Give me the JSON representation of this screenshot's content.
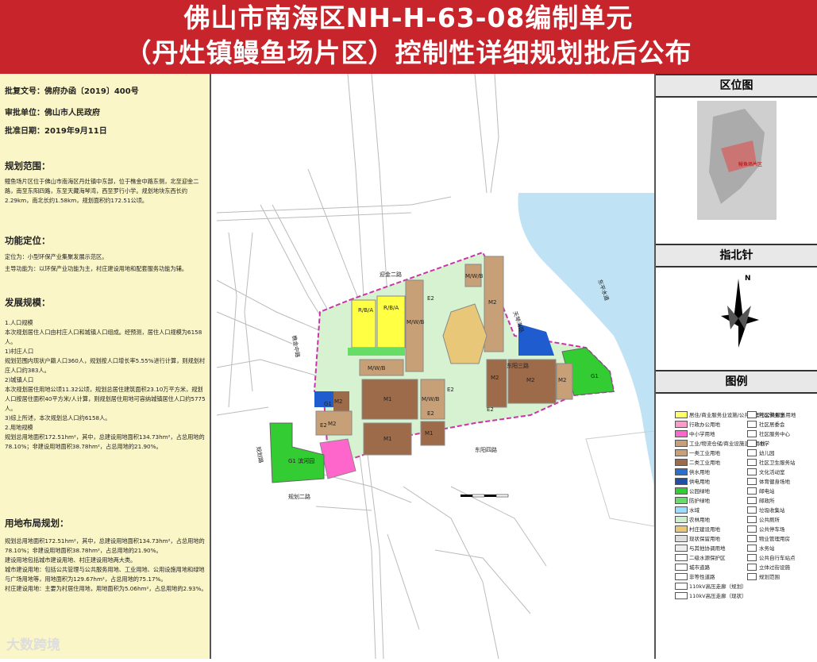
{
  "title": {
    "line1": "佛山市南海区NH-H-63-08编制单元",
    "line2": "（丹灶镇鳗鱼场片区）控制性详细规划批后公布"
  },
  "info": {
    "approval_no_label": "批复文号：",
    "approval_no": "佛府办函〔2019〕400号",
    "unit_label": "审批单位：",
    "unit": "佛山市人民政府",
    "date_label": "批准日期：",
    "date": "2019年9月11日"
  },
  "sections": {
    "scope_title": "规划范围：",
    "scope_text": "鳗鱼场片区位于佛山市南海区丹灶镇中东部，位于樵金中路东侧，北至迎金二路，南至东阳四路，东至天藏海琴湾，西至罗行小学。规划地块东西长约2.29km，南北长约1.58km，规划面积约172.51公顷。",
    "function_title": "功能定位：",
    "function_text1": "定位为：小型环保产业集聚发展示范区。",
    "function_text2": "主导功能为：以环保产业功能为主，村庄建设用地和配套服务功能为辅。",
    "dev_title": "发展规模：",
    "dev_text": "1.人口规模|本次规划居住人口由村庄人口和城镇人口组成。经预测，居住人口规模为6158人。|1)村庄人口|规划范围内现状户籍人口360人，规划按人口增长率5.55%进行计算，则规划村庄人口约383人。|2)城镇人口|本次规划居住用地公顷11.32公顷，规划总居住建筑面积23.10万平方米，规划人口按居住面积40平方米/人计算，则规划居住用地可容纳城镇居住人口约5775人。|3)综上所述，本次规划总人口约6158人。|2.用地规模|规划总用地面积172.51hm²，其中，总建设用地面积134.73hm²，占总用地的78.10%；非建设用地面积38.78hm²，占总用地的21.90%。",
    "landuse_title": "用地布局规划：",
    "landuse_text": "规划总用地面积172.51hm²，其中，总建设用地面积134.73hm²，占总用地的78.10%；非建设用地面积38.78hm²，占总用地的21.90%。|建设用地包括城市建设用地、村庄建设用地两大类。|城市建设用地：包括公共管理与公共服务用地、工业用地、公用设施用地和绿地与广场用地等，用地面积为129.67hm²，占总用地的75.17%。|村庄建设用地：主要为村居住用地，用地面积为5.06hm²，占总用地的2.93%。"
  },
  "right": {
    "location_title": "区位图",
    "north_title": "指北针",
    "legend_title": "图例",
    "north_label": "N",
    "location_caption": "鳗鱼场片区"
  },
  "legend_left": [
    {
      "label": "居住/商业服务业设施/公共管理与公共服务用地",
      "color": "#ffff66"
    },
    {
      "label": "行政办公用地",
      "color": "#ff99cc"
    },
    {
      "label": "中小学用地",
      "color": "#ff66cc"
    },
    {
      "label": "工业/物流仓储/商业设施混合用地",
      "color": "#c8a078"
    },
    {
      "label": "一类工业用地",
      "color": "#c8a078"
    },
    {
      "label": "二类工业用地",
      "color": "#9e6b4a"
    },
    {
      "label": "供水用地",
      "color": "#2a6ecf"
    },
    {
      "label": "供电用地",
      "color": "#1f4fa8"
    },
    {
      "label": "公园绿地",
      "color": "#33cc33"
    },
    {
      "label": "防护绿地",
      "color": "#66dd66"
    },
    {
      "label": "水域",
      "color": "#99ddff"
    },
    {
      "label": "农林用地",
      "color": "#ccf0cc"
    },
    {
      "label": "村庄建设用地",
      "color": "#e8c878"
    },
    {
      "label": "现状保留用地",
      "color": "#dddddd"
    },
    {
      "label": "与其他协调用地",
      "color": "#eeeeee"
    },
    {
      "label": "二级水源保护区",
      "color": "#ffffff"
    },
    {
      "label": "城市道路",
      "color": "#ffffff"
    },
    {
      "label": "非等性道路",
      "color": "#ffffff"
    },
    {
      "label": "110kV高压走廊（规划）",
      "color": "#ffffff"
    },
    {
      "label": "110kV高压走廊（现状）",
      "color": "#ffffff"
    }
  ],
  "legend_right": [
    "社区警务室",
    "社区居委会",
    "社区服务中心",
    "小学",
    "幼儿园",
    "社区卫生服务站",
    "文化活动室",
    "体育健身场地",
    "邮电站",
    "邮政所",
    "垃圾收集站",
    "公共厕所",
    "公共停车场",
    "物业管理用房",
    "水务站",
    "公共自行车站点",
    "立体过街设施",
    "规划范围"
  ],
  "map_labels": {
    "e2a": "E2",
    "e2b": "E2",
    "e2c": "E2",
    "e2d": "E2",
    "e2e": "E2",
    "m2a": "M2",
    "m2b": "M2",
    "m2c": "M2",
    "m2d": "M2",
    "m2e": "M2",
    "m2f": "M2",
    "m1a": "M1",
    "m1b": "M1",
    "m1c": "M1",
    "mwb1": "M/W/B",
    "mwb2": "M/W/B",
    "mwb3": "M/W/B",
    "mwb4": "M/W/B",
    "rba1": "R/B/A",
    "rba2": "R/B/A",
    "g1a": "G1",
    "g1b": "G1",
    "g1c": "G1 滨河园",
    "rd1": "迎金二路",
    "rd2": "东阳四路",
    "rd3": "规划二路",
    "rd4": "东阳三路",
    "rd5": "樵金中路",
    "rd6": "规划路",
    "rd7": "天琴海路",
    "river": "东平水道"
  },
  "watermark": "大数跨境"
}
